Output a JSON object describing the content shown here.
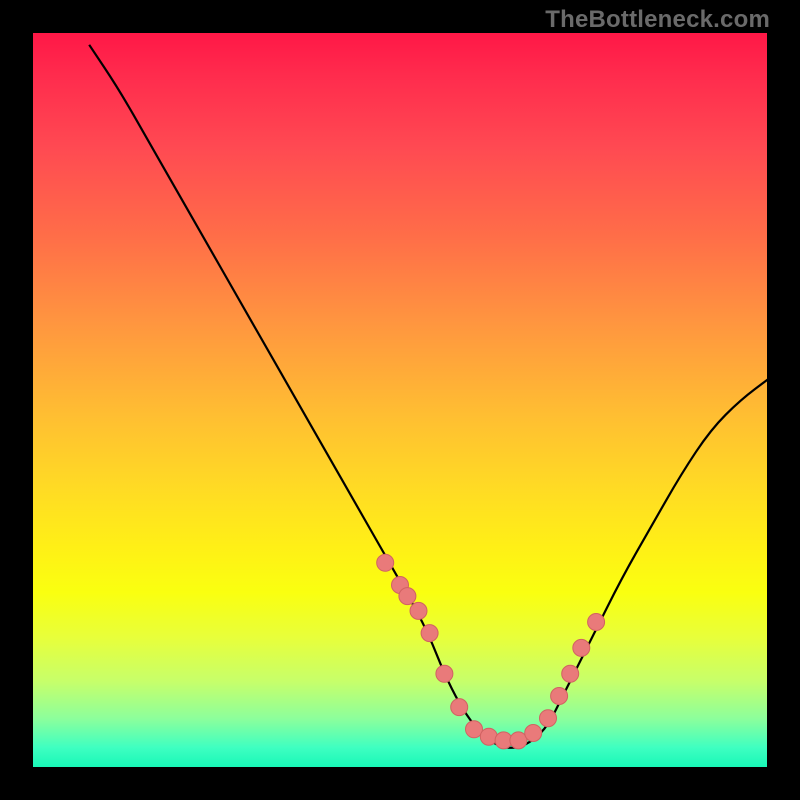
{
  "attribution": "TheBottleneck.com",
  "colors": {
    "curve_stroke": "#000000",
    "marker_fill": "#e97a7a",
    "marker_stroke": "#d16262",
    "frame_stroke": "#000000"
  },
  "chart_data": {
    "type": "line",
    "title": "",
    "xlabel": "",
    "ylabel": "",
    "xlim": [
      0,
      100
    ],
    "ylim": [
      0,
      100
    ],
    "x": [
      8,
      12,
      16,
      20,
      24,
      28,
      32,
      36,
      40,
      44,
      48,
      52,
      54,
      56,
      58,
      60,
      62,
      64,
      66,
      68,
      70,
      72,
      76,
      80,
      84,
      88,
      92,
      96,
      100
    ],
    "y": [
      98,
      92,
      85,
      78,
      71,
      64,
      57,
      50,
      43,
      36,
      29,
      22,
      18,
      13,
      9,
      6,
      4,
      3,
      3,
      4,
      6,
      10,
      18,
      26,
      33,
      40,
      46,
      50,
      53
    ],
    "markers": {
      "x": [
        48,
        50,
        51,
        52.5,
        54,
        56,
        58,
        60,
        62,
        64,
        66,
        68,
        70,
        71.5,
        73,
        74.5,
        76.5
      ],
      "y": [
        28,
        25,
        23.5,
        21.5,
        18.5,
        13,
        8.5,
        5.5,
        4.5,
        4,
        4,
        5,
        7,
        10,
        13,
        16.5,
        20
      ]
    }
  }
}
